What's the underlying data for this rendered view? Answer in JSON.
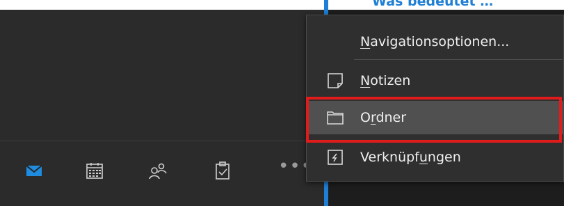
{
  "preview": {
    "text": "Was bedeutet …"
  },
  "nav_bar": {
    "icons": [
      "mail-icon",
      "calendar-icon",
      "people-icon",
      "tasks-icon"
    ],
    "more": "•••"
  },
  "menu": {
    "items": [
      {
        "pre": "",
        "key": "N",
        "post": "avigationsoptionen...",
        "icon": ""
      },
      {
        "pre": "",
        "key": "N",
        "post": "otizen",
        "icon": "notes-icon"
      },
      {
        "pre": "O",
        "key": "r",
        "post": "dner",
        "icon": "folder-icon"
      },
      {
        "pre": "Verknüpf",
        "key": "u",
        "post": "ngen",
        "icon": "shortcuts-icon"
      }
    ]
  },
  "colors": {
    "accent": "#1f7fd4",
    "highlight_border": "#e01b1b",
    "selected_bg": "#505050"
  }
}
